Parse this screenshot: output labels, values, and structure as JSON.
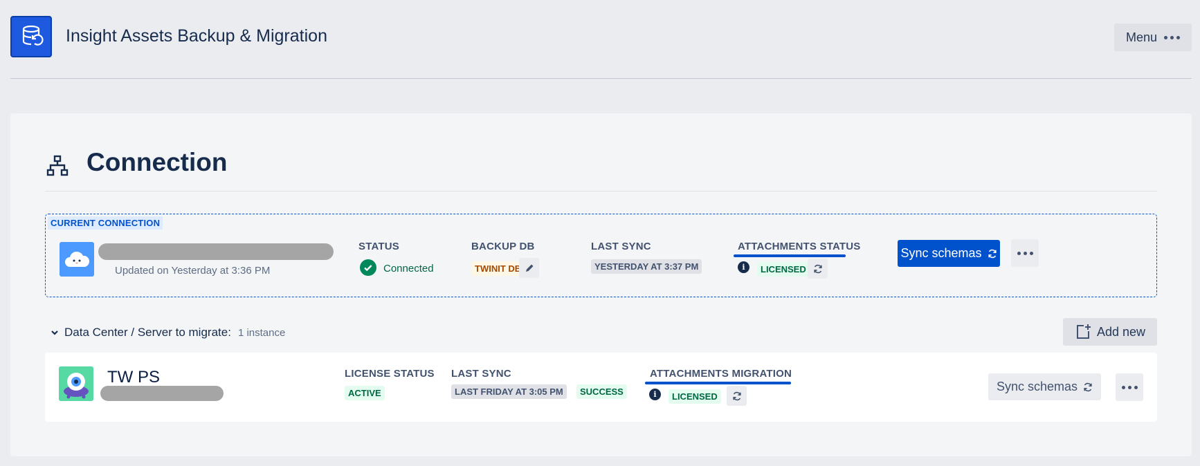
{
  "app": {
    "title": "Insight Assets Backup & Migration",
    "menu_label": "Menu"
  },
  "section": {
    "title": "Connection"
  },
  "current_connection": {
    "badge": "CURRENT CONNECTION",
    "updated": "Updated on Yesterday at 3:36 PM",
    "status_head": "STATUS",
    "status_value": "Connected",
    "backup_head": "BACKUP DB",
    "backup_value": "TWINIT DB",
    "last_sync_head": "LAST SYNC",
    "last_sync_value": "YESTERDAY AT 3:37 PM",
    "attachments_head": "ATTACHMENTS STATUS",
    "attachments_value": "LICENSED",
    "sync_button": "Sync schemas"
  },
  "data_center": {
    "label": "Data Center / Server to migrate:",
    "count": "1 instance",
    "add_new": "Add new"
  },
  "instance": {
    "name": "TW PS",
    "license_head": "LICENSE STATUS",
    "license_value": "ACTIVE",
    "last_sync_head": "LAST SYNC",
    "last_sync_value": "LAST FRIDAY AT 3:05 PM",
    "last_sync_result": "SUCCESS",
    "attachments_head": "ATTACHMENTS MIGRATION",
    "attachments_value": "LICENSED",
    "sync_button": "Sync schemas"
  },
  "colors": {
    "primary": "#0052cc",
    "success": "#00875a",
    "background": "#ebecf0"
  }
}
